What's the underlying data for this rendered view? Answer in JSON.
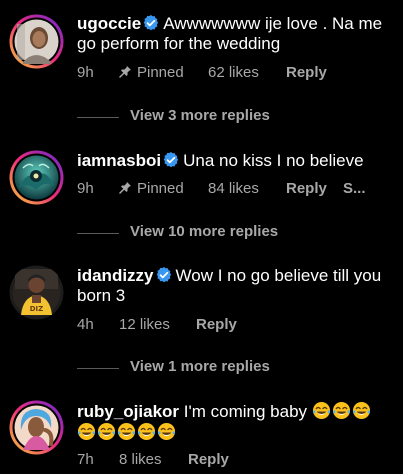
{
  "comments": [
    {
      "username": "ugoccie",
      "verified": true,
      "text": "Awwwwwww ije love . Na me go perform for the wedding",
      "time": "9h",
      "pinned_label": "Pinned",
      "likes": "62 likes",
      "reply_label": "Reply",
      "view_replies": "View 3 more replies",
      "avatar_icon": "avatar-woman-portrait"
    },
    {
      "username": "iamnasboi",
      "verified": true,
      "text": "Una no kiss I no believe",
      "time": "9h",
      "pinned_label": "Pinned",
      "likes": "84 likes",
      "reply_label": "Reply",
      "extra": "S...",
      "view_replies": "View 10 more replies",
      "avatar_icon": "avatar-teal-fantasy-art"
    },
    {
      "username": "idandizzy",
      "verified": true,
      "text": "Wow I no go believe till you born 3",
      "time": "4h",
      "likes": "12 likes",
      "reply_label": "Reply",
      "view_replies": "View 1 more replies",
      "avatar_icon": "avatar-man-yellow-jersey"
    },
    {
      "username": "ruby_ojiakor",
      "verified": false,
      "text": "I'm coming baby",
      "emoji_count_line1": 3,
      "emoji_count_line2": 5,
      "emoji_name": "face-with-tears-of-joy",
      "time": "7h",
      "likes": "8 likes",
      "reply_label": "Reply",
      "avatar_icon": "avatar-woman-blue-hair"
    }
  ],
  "colors": {
    "background": "#000000",
    "primary_text": "#ffffff",
    "secondary_text": "#a8a8a8",
    "verified_badge": "#3897f0",
    "story_ring_start": "#f9ce34",
    "story_ring_end": "#ee2a7b"
  }
}
